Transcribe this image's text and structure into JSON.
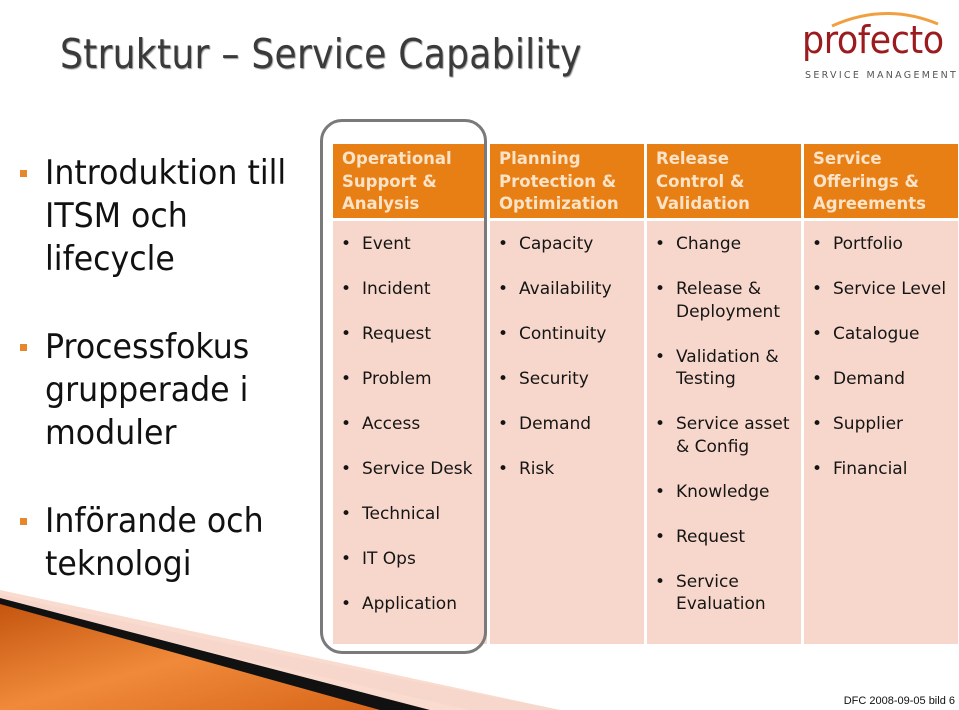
{
  "slide": {
    "title": "Struktur – Service Capability",
    "footer": "DFC 2008-09-05 bild 6"
  },
  "logo": {
    "name": "profecto",
    "tagline": "SERVICE MANAGEMENT"
  },
  "left_bullets": [
    {
      "text": "Introduktion till ITSM och lifecycle"
    },
    {
      "text": "Processfokus grupperade i moduler"
    },
    {
      "text": "Införande och teknologi"
    }
  ],
  "columns": [
    {
      "header": "Operational Support & Analysis",
      "highlighted": true,
      "items": [
        "Event",
        "Incident",
        "Request",
        "Problem",
        "Access",
        "Service Desk",
        "Technical",
        "IT Ops",
        "Application"
      ]
    },
    {
      "header": "Planning Protection & Optimization",
      "highlighted": false,
      "items": [
        "Capacity",
        "Availability",
        "Continuity",
        "Security",
        "Demand",
        "Risk"
      ]
    },
    {
      "header": "Release Control & Validation",
      "highlighted": false,
      "items": [
        "Change",
        "Release & Deployment",
        "Validation & Testing",
        "Service asset & Config",
        "Knowledge",
        "Request",
        "Service Evaluation"
      ]
    },
    {
      "header": "Service Offerings & Agreements",
      "highlighted": false,
      "items": [
        "Portfolio",
        "Service Level",
        "Catalogue",
        "Demand",
        "Supplier",
        "Financial"
      ]
    }
  ],
  "colors": {
    "accent_orange": "#e87f14",
    "cell_pink": "#f7d7cb",
    "header_text": "#fbe3c8",
    "logo_red": "#9b1b1f",
    "highlight_border": "#7a7a7a"
  }
}
